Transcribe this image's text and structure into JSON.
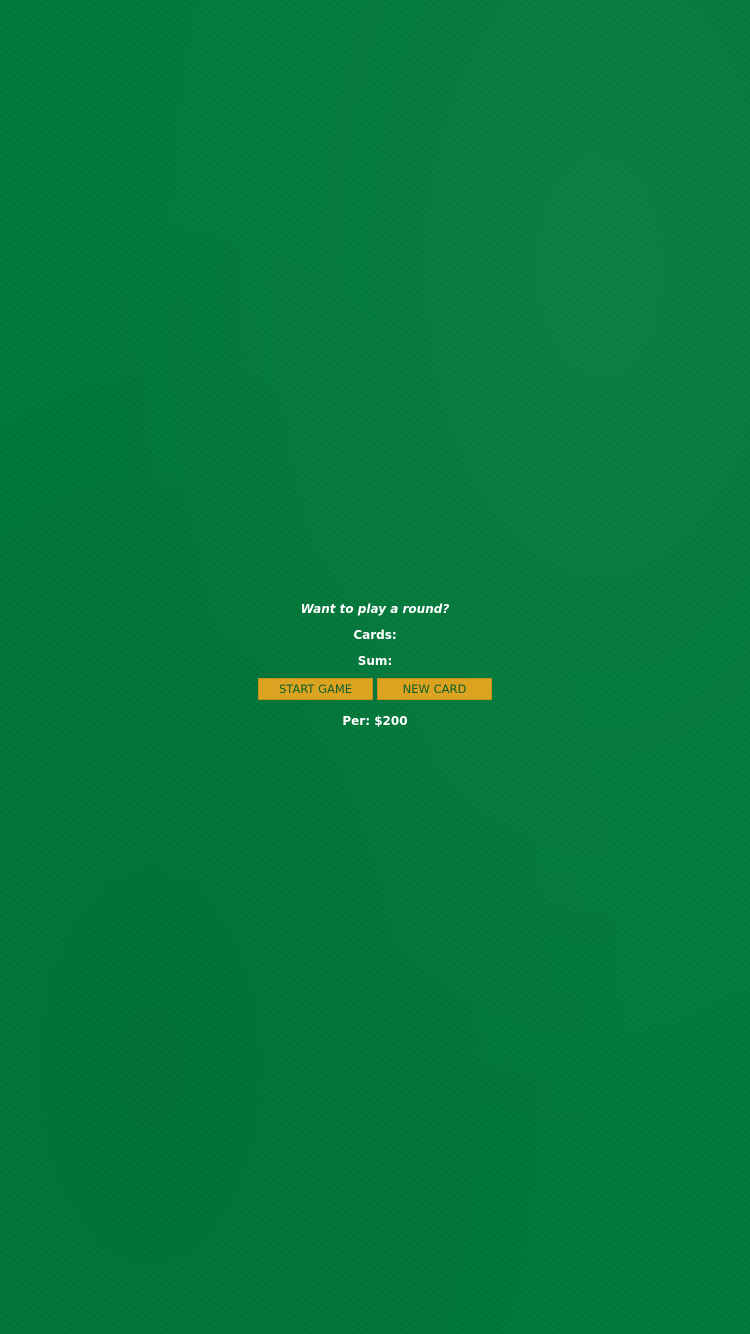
{
  "message": "Want to play a round?",
  "cards_label": "Cards:",
  "sum_label": "Sum:",
  "buttons": {
    "start": "START GAME",
    "new_card": "NEW CARD"
  },
  "player": "Per: $200",
  "colors": {
    "felt": "#00793a",
    "button": "#dba320",
    "button_text": "#0f5f2a"
  }
}
